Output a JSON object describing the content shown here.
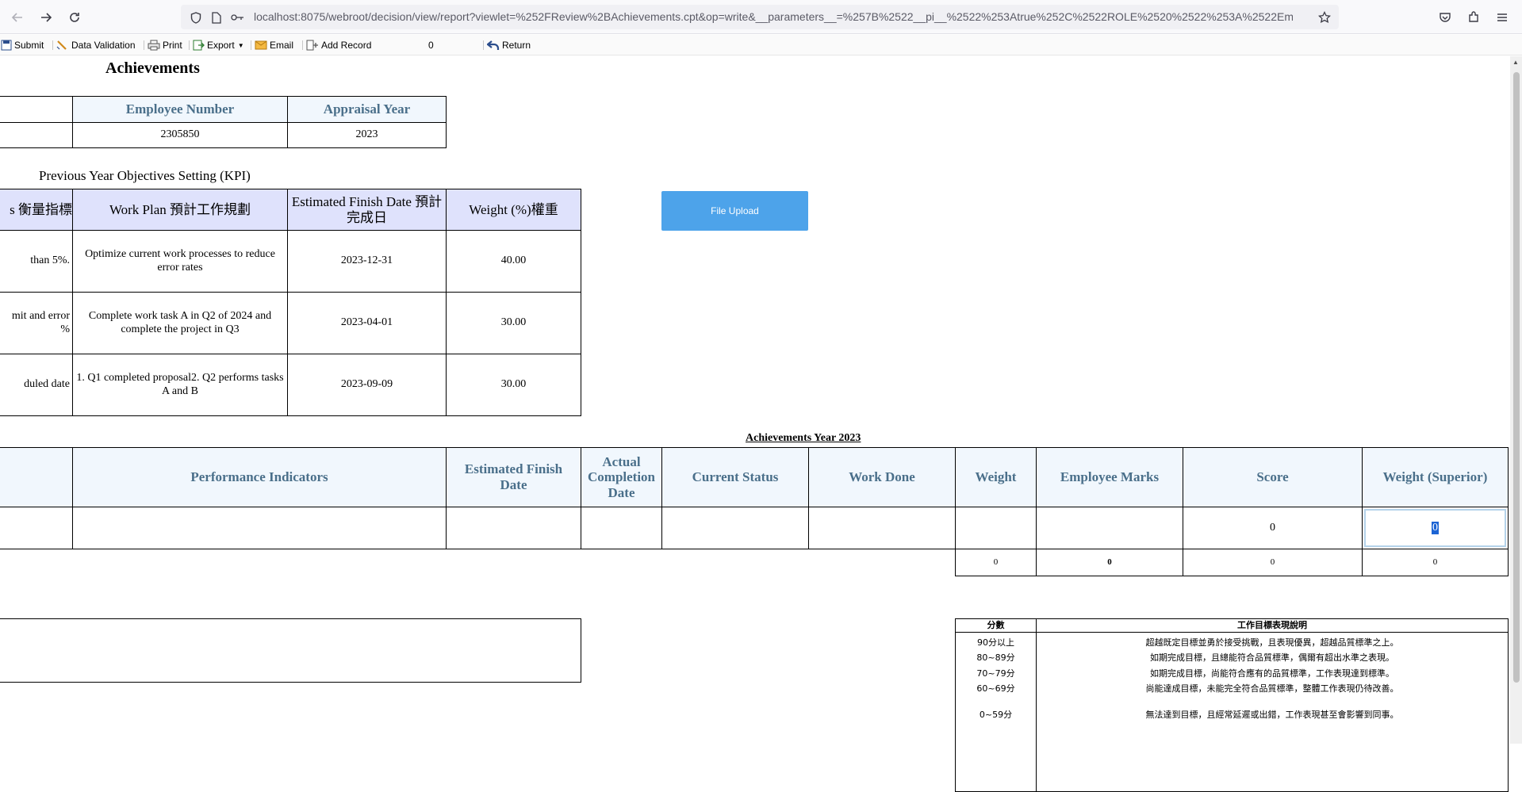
{
  "browser": {
    "url": "localhost:8075/webroot/decision/view/report?viewlet=%252FReview%2BAchievements.cpt&op=write&__parameters__=%257B%2522__pi__%2522%253Atrue%252C%2522ROLE%2520%2522%253A%2522Employee%252"
  },
  "toolbar": {
    "submit": "Submit",
    "data_validation": "Data Validation",
    "print": "Print",
    "export": "Export",
    "email": "Email",
    "add_record": "Add Record",
    "record_count": "0",
    "return": "Return"
  },
  "report": {
    "title": "Achievements",
    "info": {
      "headers": [
        "Employee Number",
        "Appraisal Year"
      ],
      "values": [
        "2305850",
        "2023"
      ]
    },
    "kpi": {
      "caption": "Previous Year Objectives Setting (KPI)",
      "headers": [
        "s 衡量指標",
        "Work Plan 預計工作規劃",
        "Estimated Finish Date 預計完成日",
        "Weight (%)權重"
      ],
      "rows": [
        [
          "than 5%.",
          "Optimize current work processes to reduce error rates",
          "2023-12-31",
          "40.00"
        ],
        [
          "mit and error %",
          "Complete work task A in Q2 of 2024 and complete the project in Q3",
          "2023-04-01",
          "30.00"
        ],
        [
          "duled date",
          "1. Q1 completed proposal2. Q2 performs tasks A and B",
          "2023-09-09",
          "30.00"
        ]
      ]
    },
    "upload_button": "File Upload",
    "achievements": {
      "caption": "Achievements Year 2023",
      "headers": [
        "",
        "Performance Indicators",
        "Estimated Finish Date",
        "Actual Completion Date",
        "Current Status",
        "Work Done",
        "Weight",
        "Employee Marks",
        "Score",
        "Weight (Superior)"
      ],
      "row": [
        "",
        "",
        "",
        "",
        "",
        "",
        "",
        "",
        "0",
        "0"
      ],
      "totals": [
        "0",
        "0",
        "0",
        "0"
      ]
    },
    "legend": {
      "headers": [
        "分數",
        "工作目標表現說明"
      ],
      "rows": [
        [
          "90分以上",
          "超越既定目標並勇於接受挑戰，且表現優異，超越品質標準之上。"
        ],
        [
          "80~89分",
          "如期完成目標，且總能符合品質標準，偶爾有超出水準之表現。"
        ],
        [
          "70~79分",
          "如期完成目標，尚能符合應有的品質標準，工作表現達到標準。"
        ],
        [
          "60~69分",
          "尚能達成目標，未能完全符合品質標準，整體工作表現仍待改善。"
        ],
        [
          "0~59分",
          "無法達到目標，且經常延遲或出錯，工作表現甚至會影響到同事。"
        ]
      ]
    }
  }
}
